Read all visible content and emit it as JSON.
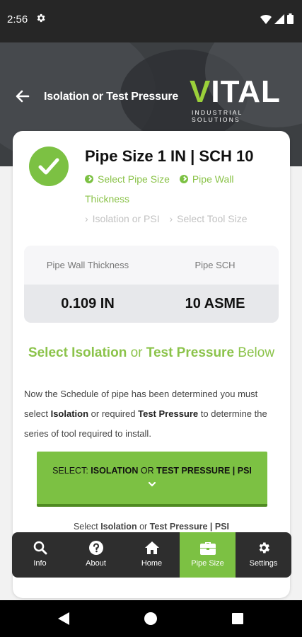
{
  "status_bar": {
    "time": "2:56"
  },
  "header": {
    "title": "Isolation or Test Pressure"
  },
  "logo": {
    "word_rest": "ITAL",
    "word_first": "V",
    "subtitle": "INDUSTRIAL SOLUTIONS"
  },
  "card": {
    "title": "Pipe Size 1 IN | SCH 10",
    "steps_done": [
      "Select Pipe Size",
      "Pipe Wall Thickness"
    ],
    "steps_pending": [
      "Isolation or PSI",
      "Select Tool Size"
    ],
    "table": {
      "headers": [
        "Pipe Wall Thickness",
        "Pipe SCH"
      ],
      "values": [
        "0.109 IN",
        "10 ASME"
      ]
    },
    "select_heading": {
      "part1": "Select Isolation",
      "part2": " or ",
      "part3": "Test Pressure",
      "part4": " Below"
    },
    "description": {
      "p1": "Now the Schedule of pipe has been determined you must select ",
      "b1": "Isolation",
      "p2": " or required ",
      "b2": "Test Pressure",
      "p3": " to determine the series of tool required to install."
    },
    "button": {
      "prefix": "SELECT: ",
      "b1": "ISOLATION",
      "mid": " OR ",
      "b2": "TEST PRESSURE | PSI"
    },
    "under_text": {
      "prefix": "Select ",
      "b1": "Isolation",
      "mid": " or ",
      "b2": "Test Pressure | PSI"
    }
  },
  "bottom_nav": [
    {
      "label": "Info",
      "icon": "search-icon"
    },
    {
      "label": "About",
      "icon": "help-icon"
    },
    {
      "label": "Home",
      "icon": "home-icon"
    },
    {
      "label": "Pipe Size",
      "icon": "toolbox-icon",
      "active": true
    },
    {
      "label": "Settings",
      "icon": "gear-icon"
    }
  ],
  "colors": {
    "accent": "#7cc143",
    "dark": "#2e2e2e"
  }
}
